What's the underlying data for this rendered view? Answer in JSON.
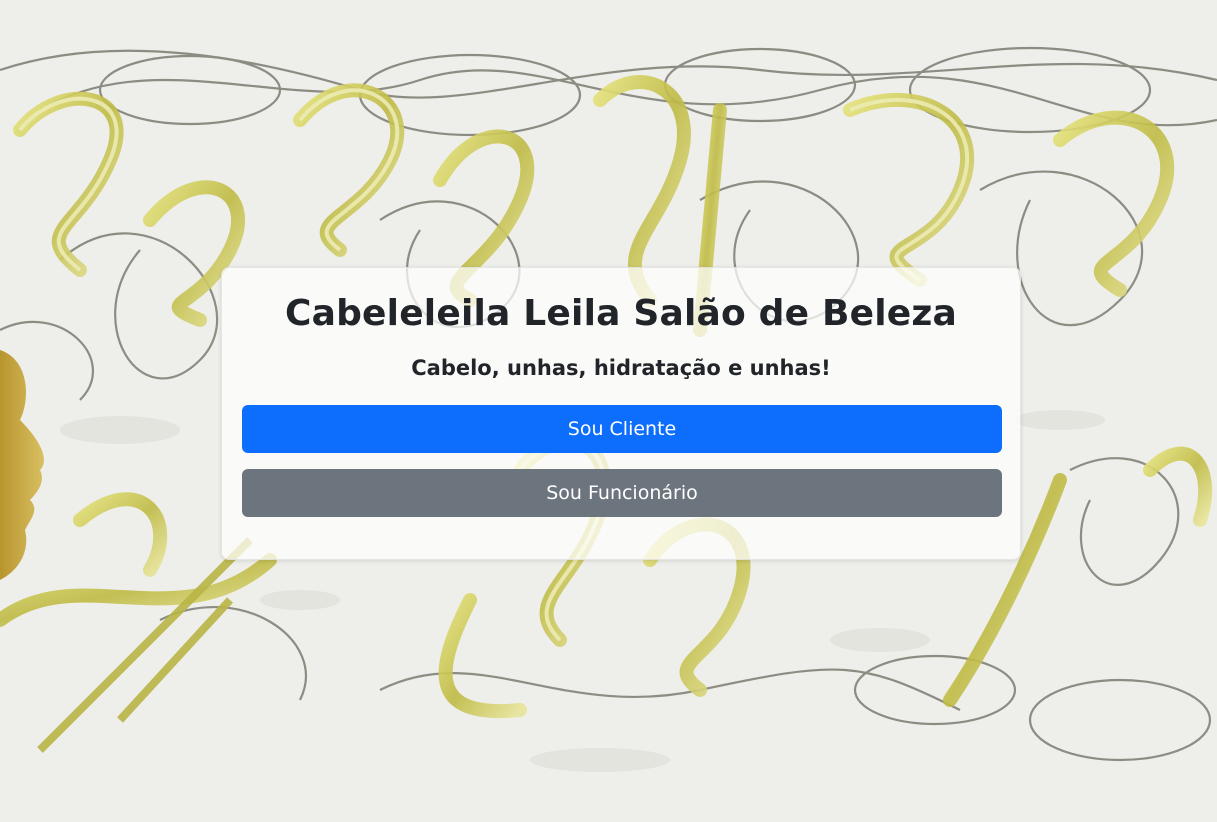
{
  "page": {
    "background_image": "decorative-calligraphy-background"
  },
  "card": {
    "title": "Cabeleleila Leila Salão de Beleza",
    "subtitle": "Cabelo, unhas, hidratação e unhas!"
  },
  "buttons": {
    "client_label": "Sou Cliente",
    "employee_label": "Sou Funcionário"
  },
  "colors": {
    "primary": "#0d6efd",
    "secondary": "#6c757d",
    "text": "#212529",
    "gold": "#c9c45a"
  }
}
